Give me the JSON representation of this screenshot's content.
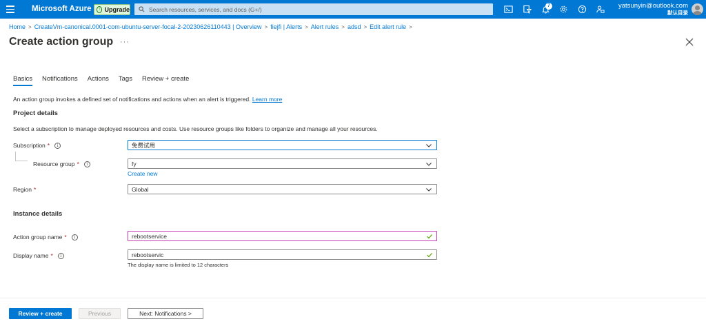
{
  "topbar": {
    "brand": "Microsoft Azure",
    "upgrade_label": "Upgrade",
    "search_placeholder": "Search resources, services, and docs (G+/)",
    "notification_count": "7",
    "account_email": "yatsunyin@outlook.com",
    "account_directory": "默认目录",
    "accent_color": "#0078d4"
  },
  "breadcrumb": [
    "Home",
    "CreateVm-canonical.0001-com-ubuntu-server-focal-2-20230626110443 | Overview",
    "fiejfi | Alerts",
    "Alert rules",
    "adsd",
    "Edit alert rule"
  ],
  "page_title": "Create action group",
  "tabs": [
    "Basics",
    "Notifications",
    "Actions",
    "Tags",
    "Review + create"
  ],
  "intro": {
    "text": "An action group invokes a defined set of notifications and actions when an alert is triggered.",
    "link": "Learn more"
  },
  "project": {
    "title": "Project details",
    "description": "Select a subscription to manage deployed resources and costs. Use resource groups like folders to organize and manage all your resources.",
    "subscription_label": "Subscription",
    "subscription_value": "免费试用",
    "resource_group_label": "Resource group",
    "resource_group_value": "fy",
    "create_new": "Create new",
    "region_label": "Region",
    "region_value": "Global"
  },
  "instance": {
    "title": "Instance details",
    "action_group_name_label": "Action group name",
    "action_group_name_value": "rebootservice",
    "display_name_label": "Display name",
    "display_name_value": "rebootservic",
    "display_name_hint": "The display name is limited to 12 characters"
  },
  "footer": {
    "review_create": "Review + create",
    "previous": "Previous",
    "next": "Next: Notifications >"
  }
}
